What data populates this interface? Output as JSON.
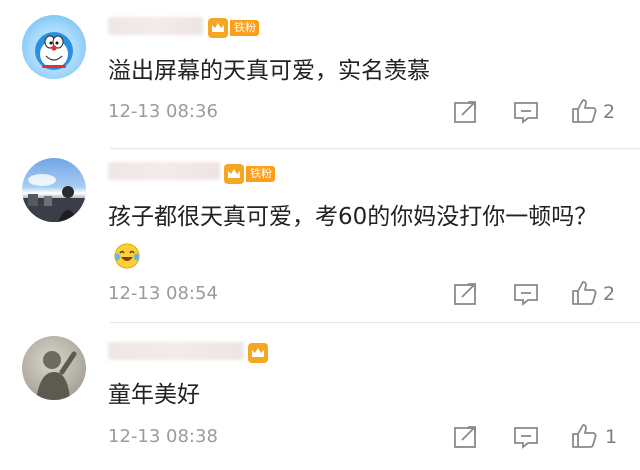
{
  "comments": [
    {
      "badge": "铁粉",
      "text": "溢出屏幕的天真可爱，实名羡慕",
      "time": "12-13 08:36",
      "likes": "2"
    },
    {
      "badge": "铁粉",
      "text": "孩子都很天真可爱，考60的你妈没打你一顿吗？",
      "time": "12-13 08:54",
      "likes": "2",
      "emoji": "laughing-tears-icon"
    },
    {
      "text": "童年美好",
      "time": "12-13 08:38",
      "likes": "1"
    }
  ],
  "colors": {
    "badge": "#ff9d19",
    "vip": "#f5a623",
    "time": "#9b9b9b",
    "icon": "#8a8a8a"
  }
}
